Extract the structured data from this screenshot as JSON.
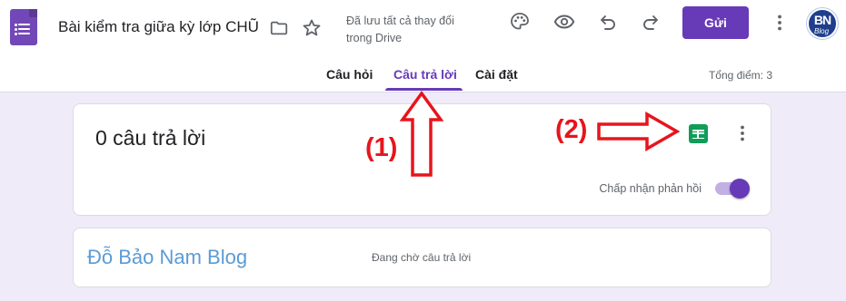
{
  "header": {
    "title": "Bài kiểm tra giữa kỳ lớp CHŨ",
    "save_status_line1": "Đã lưu tất cả thay đổi",
    "save_status_line2": "trong Drive",
    "send_label": "Gửi",
    "avatar_text": "BN",
    "avatar_subtext": "Blog",
    "icons": [
      "forms-logo-icon",
      "folder-icon",
      "star-icon",
      "palette-icon",
      "preview-eye-icon",
      "undo-icon",
      "redo-icon",
      "more-vert-icon"
    ]
  },
  "tabs": [
    {
      "label": "Câu hỏi",
      "active": false
    },
    {
      "label": "Câu trả lời",
      "active": true
    },
    {
      "label": "Cài đặt",
      "active": false
    }
  ],
  "total_points": "Tổng điểm: 3",
  "summary_card": {
    "response_count": "0 câu trả lời",
    "accept_label": "Chấp nhận phản hồi",
    "accepting": true,
    "icons": [
      "sheets-icon",
      "more-vert-icon"
    ]
  },
  "user_card": {
    "name": "Đỗ Bảo Nam Blog",
    "status": "Đang chờ câu trả lời"
  },
  "annotations": [
    {
      "label": "(1)"
    },
    {
      "label": "(2)"
    }
  ],
  "colors": {
    "accent": "#673ab7",
    "background": "#f0ebf8",
    "sheets_green": "#0f9d58",
    "annotation_red": "#e8141c",
    "user_name_blue": "#5b9bd5"
  }
}
